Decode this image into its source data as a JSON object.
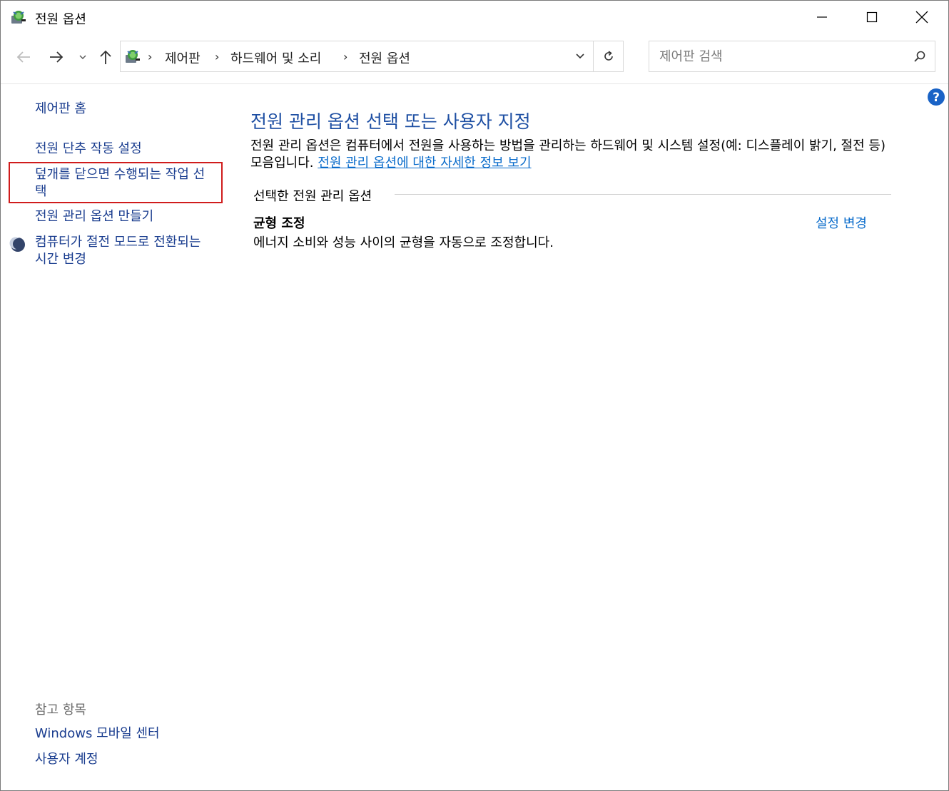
{
  "window": {
    "title": "전원 옵션"
  },
  "address": {
    "crumbs": [
      "제어판",
      "하드웨어 및 소리",
      "전원 옵션"
    ]
  },
  "search": {
    "placeholder": "제어판 검색"
  },
  "sidebar": {
    "home": "제어판 홈",
    "links": [
      "전원 단추 작동 설정",
      "덮개를 닫으면 수행되는 작업 선택",
      "전원 관리 옵션 만들기",
      "컴퓨터가 절전 모드로 전환되는 시간 변경"
    ],
    "see_also": {
      "header": "참고 항목",
      "items": [
        "Windows 모바일 센터",
        "사용자 계정"
      ]
    }
  },
  "main": {
    "title": "전원 관리 옵션 선택 또는 사용자 지정",
    "description": "전원 관리 옵션은 컴퓨터에서 전원을 사용하는 방법을 관리하는 하드웨어 및 시스템 설정(예: 디스플레이 밝기, 절전 등) 모음입니다.",
    "learn_more_link": "전원 관리 옵션에 대한 자세한 정보 보기",
    "group_header": "선택한 전원 관리 옵션",
    "plan": {
      "name": "균형 조정",
      "description": "에너지 소비와 성능 사이의 균형을 자동으로 조정합니다.",
      "change_link": "설정 변경"
    }
  },
  "colors": {
    "link": "#1a3d8f",
    "accent_blue": "#0a6ccb",
    "title_blue": "#1e4fa3",
    "highlight_border": "#d01c1c"
  }
}
